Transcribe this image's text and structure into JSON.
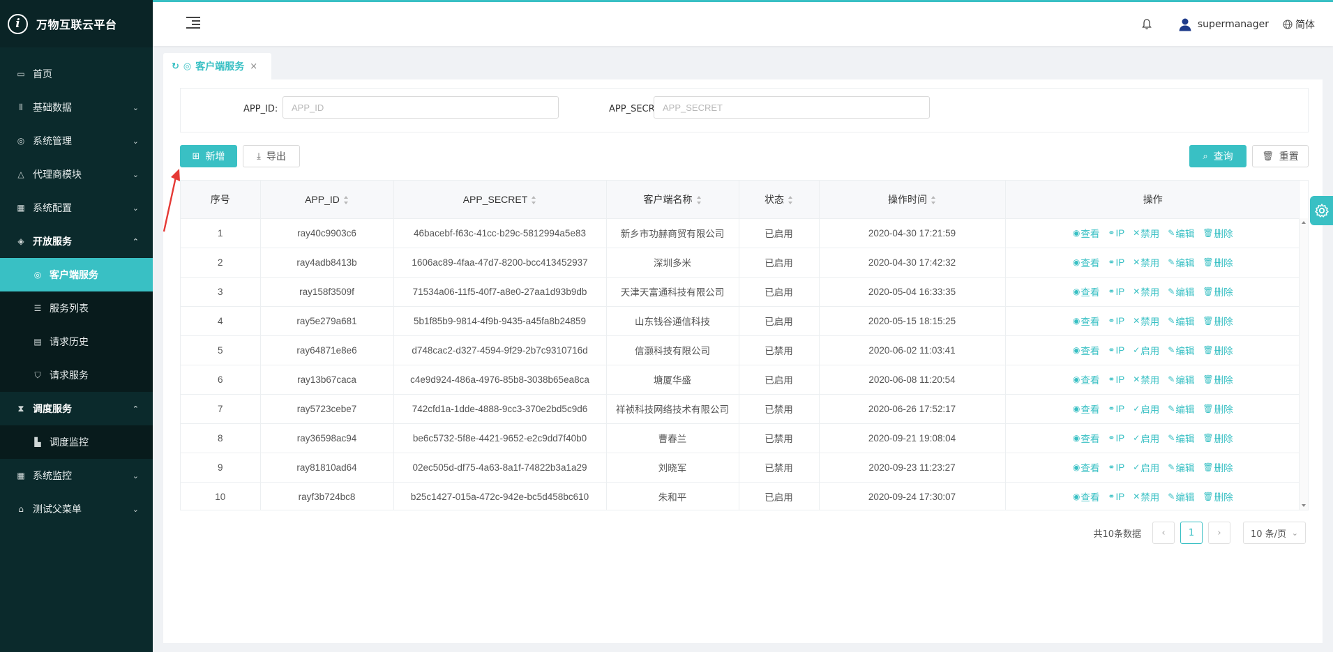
{
  "app": {
    "logo_glyph": "i",
    "title": "万物互联云平台"
  },
  "sidebar": {
    "items": [
      {
        "label": "首页",
        "icon": "calendar-icon"
      },
      {
        "label": "基础数据",
        "icon": "barcode-icon"
      },
      {
        "label": "系统管理",
        "icon": "camera-icon"
      },
      {
        "label": "代理商模块",
        "icon": "bell-icon"
      },
      {
        "label": "系统配置",
        "icon": "grid-icon"
      },
      {
        "label": "开放服务",
        "icon": "tag-icon"
      },
      {
        "label": "调度服务",
        "icon": "hourglass-icon"
      },
      {
        "label": "系统监控",
        "icon": "grid-icon"
      },
      {
        "label": "测试父菜单",
        "icon": "bank-icon"
      }
    ],
    "open_service_sub": [
      {
        "label": "客户端服务",
        "icon": "target-icon"
      },
      {
        "label": "服务列表",
        "icon": "list-icon"
      },
      {
        "label": "请求历史",
        "icon": "history-icon"
      },
      {
        "label": "请求服务",
        "icon": "shield-icon"
      }
    ],
    "schedule_sub": [
      {
        "label": "调度监控",
        "icon": "bar-chart-icon"
      }
    ]
  },
  "header": {
    "user": "supermanager",
    "lang": "简体"
  },
  "tab": {
    "label": "客户端服务",
    "close": "×"
  },
  "search": {
    "app_id_label": "APP_ID:",
    "app_id_placeholder": "APP_ID",
    "app_secret_label": "APP_SECRET:",
    "app_secret_placeholder": "APP_SECRET"
  },
  "toolbar": {
    "add": "新增",
    "export": "导出",
    "query": "查询",
    "reset": "重置"
  },
  "table": {
    "columns": [
      "序号",
      "APP_ID",
      "APP_SECRET",
      "客户端名称",
      "状态",
      "操作时间",
      "操作"
    ],
    "op_labels": {
      "view": "查看",
      "ip": "IP",
      "disable": "禁用",
      "enable": "启用",
      "edit": "编辑",
      "delete": "删除"
    },
    "rows": [
      {
        "no": "1",
        "app_id": "ray40c9903c6",
        "secret": "46bacebf-f63c-41cc-b29c-5812994a5e83",
        "name": "新乡市功赫商贸有限公司",
        "status": "已启用",
        "time": "2020-04-30 17:21:59",
        "toggle": "禁用"
      },
      {
        "no": "2",
        "app_id": "ray4adb8413b",
        "secret": "1606ac89-4faa-47d7-8200-bcc413452937",
        "name": "深圳多米",
        "status": "已启用",
        "time": "2020-04-30 17:42:32",
        "toggle": "禁用"
      },
      {
        "no": "3",
        "app_id": "ray158f3509f",
        "secret": "71534a06-11f5-40f7-a8e0-27aa1d93b9db",
        "name": "天津天富通科技有限公司",
        "status": "已启用",
        "time": "2020-05-04 16:33:35",
        "toggle": "禁用"
      },
      {
        "no": "4",
        "app_id": "ray5e279a681",
        "secret": "5b1f85b9-9814-4f9b-9435-a45fa8b24859",
        "name": "山东钱谷通信科技",
        "status": "已启用",
        "time": "2020-05-15 18:15:25",
        "toggle": "禁用"
      },
      {
        "no": "5",
        "app_id": "ray64871e8e6",
        "secret": "d748cac2-d327-4594-9f29-2b7c9310716d",
        "name": "信灏科技有限公司",
        "status": "已禁用",
        "time": "2020-06-02 11:03:41",
        "toggle": "启用"
      },
      {
        "no": "6",
        "app_id": "ray13b67caca",
        "secret": "c4e9d924-486a-4976-85b8-3038b65ea8ca",
        "name": "塘厦华盛",
        "status": "已启用",
        "time": "2020-06-08 11:20:54",
        "toggle": "禁用"
      },
      {
        "no": "7",
        "app_id": "ray5723cebe7",
        "secret": "742cfd1a-1dde-4888-9cc3-370e2bd5c9d6",
        "name": "祥祯科技网络技术有限公司",
        "status": "已禁用",
        "time": "2020-06-26 17:52:17",
        "toggle": "启用"
      },
      {
        "no": "8",
        "app_id": "ray36598ac94",
        "secret": "be6c5732-5f8e-4421-9652-e2c9dd7f40b0",
        "name": "曹春兰",
        "status": "已禁用",
        "time": "2020-09-21 19:08:04",
        "toggle": "启用"
      },
      {
        "no": "9",
        "app_id": "ray81810ad64",
        "secret": "02ec505d-df75-4a63-8a1f-74822b3a1a29",
        "name": "刘晓军",
        "status": "已禁用",
        "time": "2020-09-23 11:23:27",
        "toggle": "启用"
      },
      {
        "no": "10",
        "app_id": "rayf3b724bc8",
        "secret": "b25c1427-015a-472c-942e-bc5d458bc610",
        "name": "朱和平",
        "status": "已启用",
        "time": "2020-09-24 17:30:07",
        "toggle": "禁用"
      }
    ]
  },
  "pagination": {
    "total": "共10条数据",
    "current": "1",
    "page_size": "10 条/页"
  },
  "colors": {
    "accent": "#39c0c4",
    "sidebar_bg": "#0b2a2c",
    "annotation": "#e53935"
  }
}
